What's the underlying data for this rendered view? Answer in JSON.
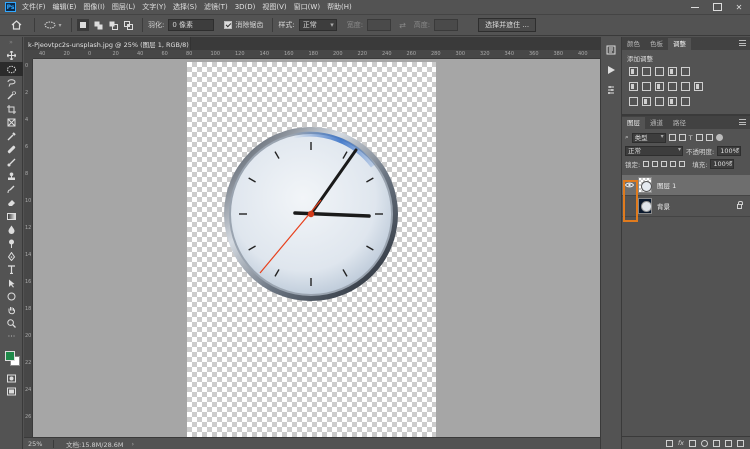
{
  "app": {
    "logo_text": "Ps",
    "menu": [
      "文件(F)",
      "编辑(E)",
      "图像(I)",
      "图层(L)",
      "文字(Y)",
      "选择(S)",
      "滤镜(T)",
      "3D(D)",
      "视图(V)",
      "窗口(W)",
      "帮助(H)"
    ]
  },
  "options_bar": {
    "feather_label": "羽化:",
    "feather_value": "0 像素",
    "antialias_label": "消除锯齿",
    "style_label": "样式:",
    "style_value": "正常",
    "width_label": "宽度:",
    "height_label": "高度:",
    "select_and_mask_label": "选择并遮住 ..."
  },
  "document": {
    "tab_title": "k-Pjeovtpc2s-unsplash.jpg @ 25% (图层 1, RGB/8) *",
    "close_symbol": "×"
  },
  "ruler": {
    "top_ticks": [
      "40",
      "20",
      "0",
      "20",
      "40",
      "60",
      "80",
      "100",
      "120",
      "140",
      "160",
      "180",
      "200",
      "220",
      "240",
      "260",
      "280",
      "300",
      "320",
      "340",
      "360",
      "380",
      "400"
    ],
    "left_ticks": [
      "0",
      "2",
      "4",
      "6",
      "8",
      "10",
      "12",
      "14",
      "16",
      "18",
      "20",
      "22",
      "24",
      "26"
    ]
  },
  "status": {
    "zoom": "25%",
    "doc_size": "文档:15.8M/28.6M",
    "arrow": "›"
  },
  "adjust_panel": {
    "tabs": [
      "颜色",
      "色板",
      "调整"
    ],
    "active_tab": 2,
    "title": "添加调整"
  },
  "layers_panel": {
    "tabs": [
      "图层",
      "通道",
      "路径"
    ],
    "active_tab": 0,
    "filter_kind": "类型",
    "blend_mode": "正常",
    "opacity_label": "不透明度:",
    "opacity_value": "100%",
    "lock_label": "锁定:",
    "fill_label": "填充:",
    "fill_value": "100%",
    "layers": [
      {
        "name": "图层 1",
        "visible": true,
        "selected": true
      },
      {
        "name": "背景",
        "visible": false,
        "selected": false,
        "locked": true
      }
    ],
    "footer_fx": "fx"
  },
  "colors": {
    "foreground": "#1f8a4a",
    "background": "#ffffff",
    "highlight": "#e07b1e",
    "clock_second_hand": "#e8401c"
  }
}
